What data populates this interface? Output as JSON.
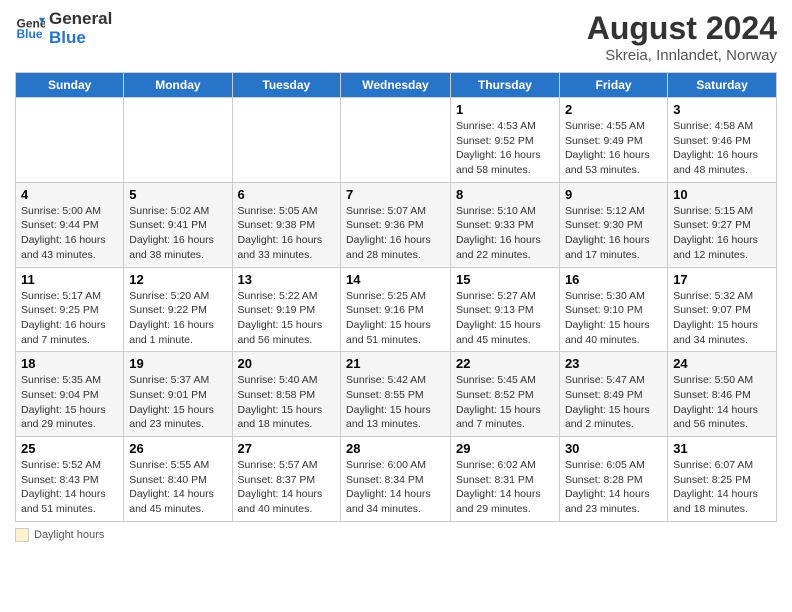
{
  "header": {
    "logo_line1": "General",
    "logo_line2": "Blue",
    "title": "August 2024",
    "subtitle": "Skreia, Innlandet, Norway"
  },
  "days_of_week": [
    "Sunday",
    "Monday",
    "Tuesday",
    "Wednesday",
    "Thursday",
    "Friday",
    "Saturday"
  ],
  "weeks": [
    [
      {
        "num": "",
        "info": ""
      },
      {
        "num": "",
        "info": ""
      },
      {
        "num": "",
        "info": ""
      },
      {
        "num": "",
        "info": ""
      },
      {
        "num": "1",
        "info": "Sunrise: 4:53 AM\nSunset: 9:52 PM\nDaylight: 16 hours and 58 minutes."
      },
      {
        "num": "2",
        "info": "Sunrise: 4:55 AM\nSunset: 9:49 PM\nDaylight: 16 hours and 53 minutes."
      },
      {
        "num": "3",
        "info": "Sunrise: 4:58 AM\nSunset: 9:46 PM\nDaylight: 16 hours and 48 minutes."
      }
    ],
    [
      {
        "num": "4",
        "info": "Sunrise: 5:00 AM\nSunset: 9:44 PM\nDaylight: 16 hours and 43 minutes."
      },
      {
        "num": "5",
        "info": "Sunrise: 5:02 AM\nSunset: 9:41 PM\nDaylight: 16 hours and 38 minutes."
      },
      {
        "num": "6",
        "info": "Sunrise: 5:05 AM\nSunset: 9:38 PM\nDaylight: 16 hours and 33 minutes."
      },
      {
        "num": "7",
        "info": "Sunrise: 5:07 AM\nSunset: 9:36 PM\nDaylight: 16 hours and 28 minutes."
      },
      {
        "num": "8",
        "info": "Sunrise: 5:10 AM\nSunset: 9:33 PM\nDaylight: 16 hours and 22 minutes."
      },
      {
        "num": "9",
        "info": "Sunrise: 5:12 AM\nSunset: 9:30 PM\nDaylight: 16 hours and 17 minutes."
      },
      {
        "num": "10",
        "info": "Sunrise: 5:15 AM\nSunset: 9:27 PM\nDaylight: 16 hours and 12 minutes."
      }
    ],
    [
      {
        "num": "11",
        "info": "Sunrise: 5:17 AM\nSunset: 9:25 PM\nDaylight: 16 hours and 7 minutes."
      },
      {
        "num": "12",
        "info": "Sunrise: 5:20 AM\nSunset: 9:22 PM\nDaylight: 16 hours and 1 minute."
      },
      {
        "num": "13",
        "info": "Sunrise: 5:22 AM\nSunset: 9:19 PM\nDaylight: 15 hours and 56 minutes."
      },
      {
        "num": "14",
        "info": "Sunrise: 5:25 AM\nSunset: 9:16 PM\nDaylight: 15 hours and 51 minutes."
      },
      {
        "num": "15",
        "info": "Sunrise: 5:27 AM\nSunset: 9:13 PM\nDaylight: 15 hours and 45 minutes."
      },
      {
        "num": "16",
        "info": "Sunrise: 5:30 AM\nSunset: 9:10 PM\nDaylight: 15 hours and 40 minutes."
      },
      {
        "num": "17",
        "info": "Sunrise: 5:32 AM\nSunset: 9:07 PM\nDaylight: 15 hours and 34 minutes."
      }
    ],
    [
      {
        "num": "18",
        "info": "Sunrise: 5:35 AM\nSunset: 9:04 PM\nDaylight: 15 hours and 29 minutes."
      },
      {
        "num": "19",
        "info": "Sunrise: 5:37 AM\nSunset: 9:01 PM\nDaylight: 15 hours and 23 minutes."
      },
      {
        "num": "20",
        "info": "Sunrise: 5:40 AM\nSunset: 8:58 PM\nDaylight: 15 hours and 18 minutes."
      },
      {
        "num": "21",
        "info": "Sunrise: 5:42 AM\nSunset: 8:55 PM\nDaylight: 15 hours and 13 minutes."
      },
      {
        "num": "22",
        "info": "Sunrise: 5:45 AM\nSunset: 8:52 PM\nDaylight: 15 hours and 7 minutes."
      },
      {
        "num": "23",
        "info": "Sunrise: 5:47 AM\nSunset: 8:49 PM\nDaylight: 15 hours and 2 minutes."
      },
      {
        "num": "24",
        "info": "Sunrise: 5:50 AM\nSunset: 8:46 PM\nDaylight: 14 hours and 56 minutes."
      }
    ],
    [
      {
        "num": "25",
        "info": "Sunrise: 5:52 AM\nSunset: 8:43 PM\nDaylight: 14 hours and 51 minutes."
      },
      {
        "num": "26",
        "info": "Sunrise: 5:55 AM\nSunset: 8:40 PM\nDaylight: 14 hours and 45 minutes."
      },
      {
        "num": "27",
        "info": "Sunrise: 5:57 AM\nSunset: 8:37 PM\nDaylight: 14 hours and 40 minutes."
      },
      {
        "num": "28",
        "info": "Sunrise: 6:00 AM\nSunset: 8:34 PM\nDaylight: 14 hours and 34 minutes."
      },
      {
        "num": "29",
        "info": "Sunrise: 6:02 AM\nSunset: 8:31 PM\nDaylight: 14 hours and 29 minutes."
      },
      {
        "num": "30",
        "info": "Sunrise: 6:05 AM\nSunset: 8:28 PM\nDaylight: 14 hours and 23 minutes."
      },
      {
        "num": "31",
        "info": "Sunrise: 6:07 AM\nSunset: 8:25 PM\nDaylight: 14 hours and 18 minutes."
      }
    ]
  ],
  "legend": {
    "daylight_label": "Daylight hours"
  }
}
